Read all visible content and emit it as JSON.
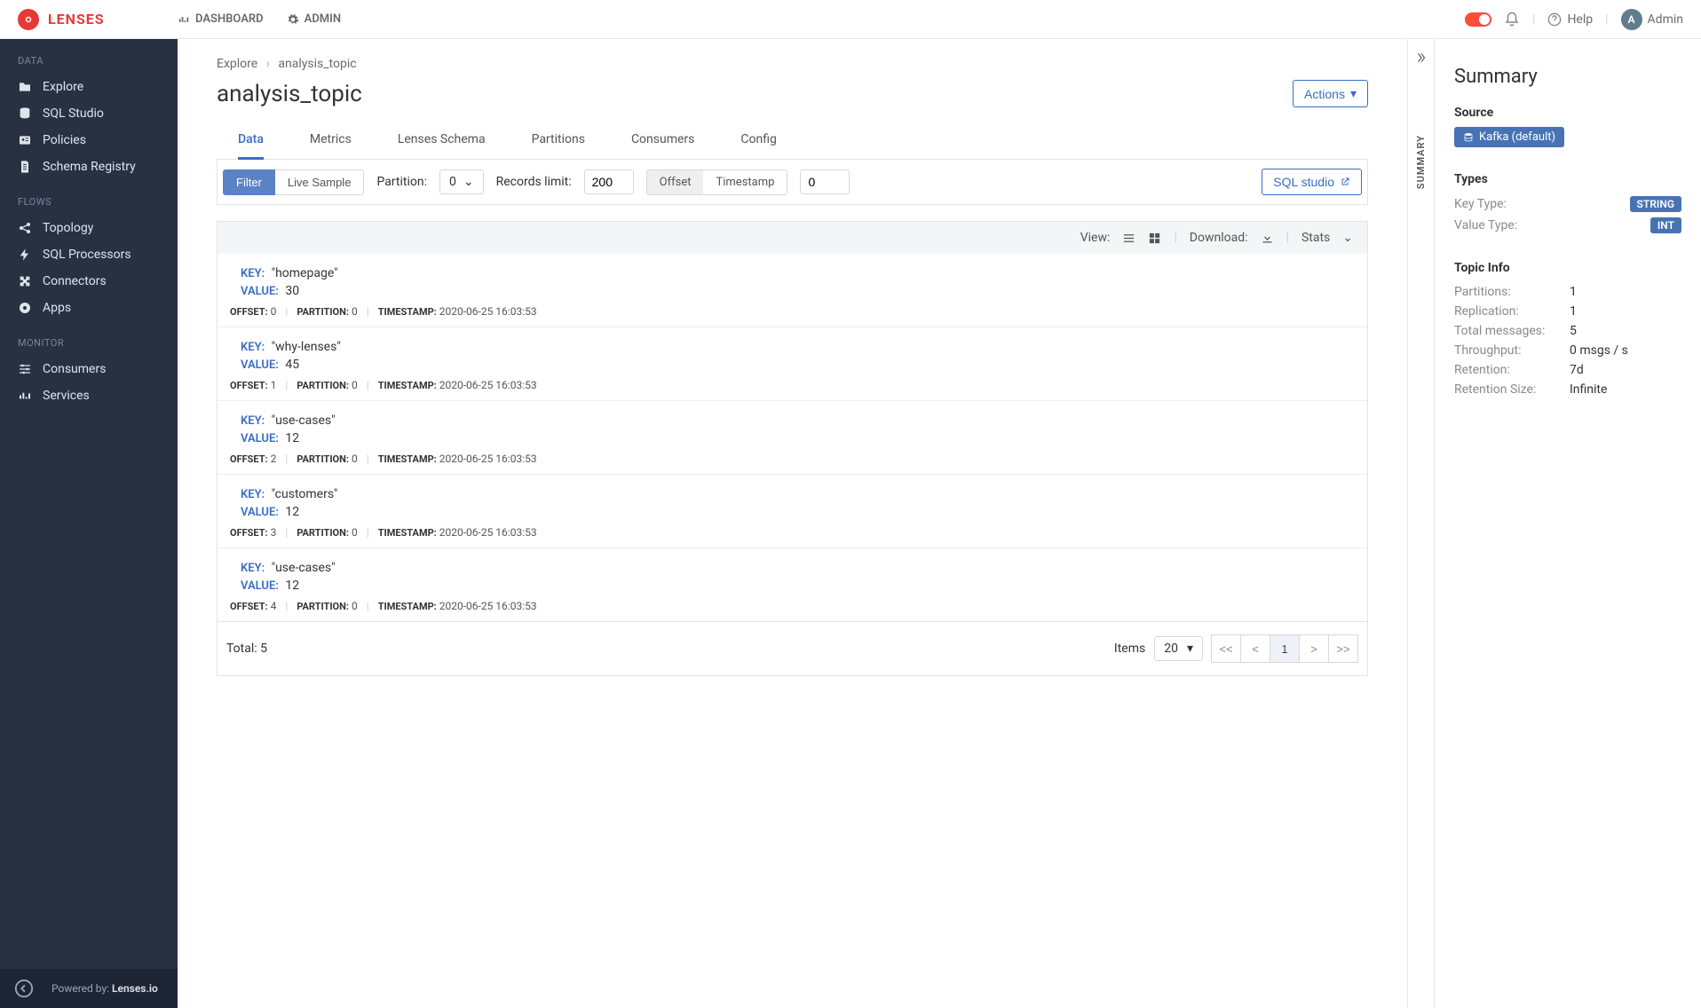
{
  "brand": "LENSES",
  "topnav": {
    "dashboard": "DASHBOARD",
    "admin": "ADMIN"
  },
  "topright": {
    "help": "Help",
    "admin_label": "Admin",
    "avatar_initial": "A"
  },
  "sidebar": {
    "sections": {
      "data": {
        "label": "DATA",
        "items": [
          "Explore",
          "SQL Studio",
          "Policies",
          "Schema Registry"
        ]
      },
      "flows": {
        "label": "FLOWS",
        "items": [
          "Topology",
          "SQL Processors",
          "Connectors",
          "Apps"
        ]
      },
      "monitor": {
        "label": "MONITOR",
        "items": [
          "Consumers",
          "Services"
        ]
      }
    },
    "footer_prefix": "Powered by: ",
    "footer_brand": "Lenses.io"
  },
  "breadcrumb": {
    "root": "Explore",
    "current": "analysis_topic"
  },
  "page_title": "analysis_topic",
  "actions_label": "Actions",
  "tabs": [
    "Data",
    "Metrics",
    "Lenses Schema",
    "Partitions",
    "Consumers",
    "Config"
  ],
  "active_tab": "Data",
  "filterbar": {
    "filter": "Filter",
    "live_sample": "Live Sample",
    "partition_label": "Partition:",
    "partition_value": "0",
    "records_limit_label": "Records limit:",
    "records_limit_value": "200",
    "offset": "Offset",
    "timestamp": "Timestamp",
    "ts_value": "0",
    "sql_studio": "SQL studio"
  },
  "data_toolbar": {
    "view": "View:",
    "download": "Download:",
    "stats": "Stats"
  },
  "records": [
    {
      "key": "\"homepage\"",
      "value": "30",
      "offset": "0",
      "partition": "0",
      "timestamp": "2020-06-25 16:03:53"
    },
    {
      "key": "\"why-lenses\"",
      "value": "45",
      "offset": "1",
      "partition": "0",
      "timestamp": "2020-06-25 16:03:53"
    },
    {
      "key": "\"use-cases\"",
      "value": "12",
      "offset": "2",
      "partition": "0",
      "timestamp": "2020-06-25 16:03:53"
    },
    {
      "key": "\"customers\"",
      "value": "12",
      "offset": "3",
      "partition": "0",
      "timestamp": "2020-06-25 16:03:53"
    },
    {
      "key": "\"use-cases\"",
      "value": "12",
      "offset": "4",
      "partition": "0",
      "timestamp": "2020-06-25 16:03:53"
    }
  ],
  "record_labels": {
    "key": "KEY:",
    "value": "VALUE:",
    "offset": "OFFSET:",
    "partition": "PARTITION:",
    "timestamp": "TIMESTAMP:"
  },
  "pager": {
    "total_label": "Total: ",
    "total": "5",
    "items_label": "Items",
    "page_size": "20",
    "first": "<<",
    "prev": "<",
    "current": "1",
    "next": ">",
    "last": ">>"
  },
  "vtab_label": "SUMMARY",
  "summary": {
    "heading": "Summary",
    "source_label": "Source",
    "source_value": "Kafka (default)",
    "types_label": "Types",
    "key_type_label": "Key Type:",
    "key_type": "STRING",
    "value_type_label": "Value Type:",
    "value_type": "INT",
    "topic_info_label": "Topic Info",
    "info": [
      {
        "k": "Partitions:",
        "v": "1"
      },
      {
        "k": "Replication:",
        "v": "1"
      },
      {
        "k": "Total messages:",
        "v": "5"
      },
      {
        "k": "Throughput:",
        "v": "0 msgs / s"
      },
      {
        "k": "Retention:",
        "v": "7d"
      },
      {
        "k": "Retention Size:",
        "v": "Infinite"
      }
    ]
  }
}
